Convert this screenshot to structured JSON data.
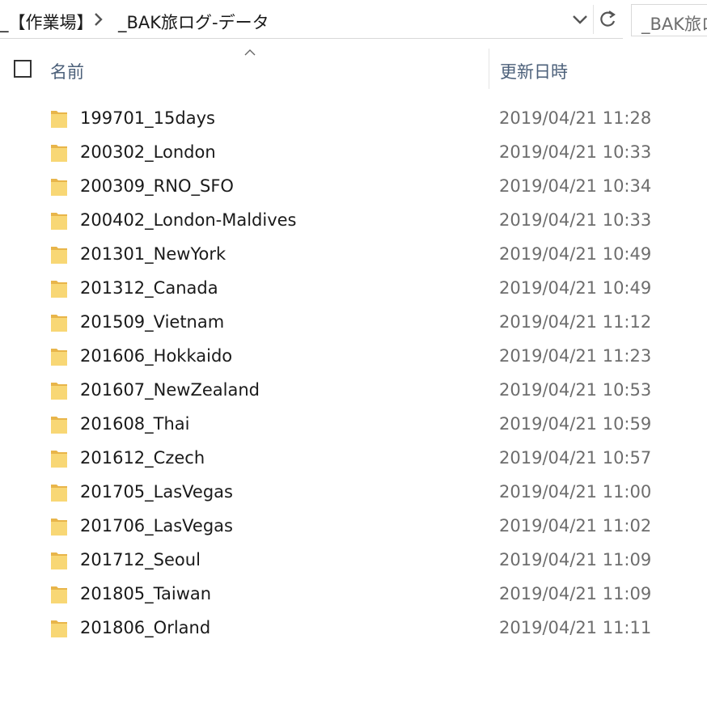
{
  "address_bar": {
    "parent_crumb": "_【作業場】",
    "current_crumb": "_BAK旅ログ-データ",
    "separator_icon": "chevron-right-icon",
    "dropdown_icon": "chevron-down-icon",
    "refresh_icon": "refresh-icon"
  },
  "search": {
    "text": "_BAK旅ロ"
  },
  "columns": {
    "name": "名前",
    "date_modified": "更新日時",
    "sort_icon": "sort-up-icon"
  },
  "files": [
    {
      "name": "199701_15days",
      "date": "2019/04/21 11:28"
    },
    {
      "name": "200302_London",
      "date": "2019/04/21 10:33"
    },
    {
      "name": "200309_RNO_SFO",
      "date": "2019/04/21 10:34"
    },
    {
      "name": "200402_London-Maldives",
      "date": "2019/04/21 10:33"
    },
    {
      "name": "201301_NewYork",
      "date": "2019/04/21 10:49"
    },
    {
      "name": "201312_Canada",
      "date": "2019/04/21 10:49"
    },
    {
      "name": "201509_Vietnam",
      "date": "2019/04/21 11:12"
    },
    {
      "name": "201606_Hokkaido",
      "date": "2019/04/21 11:23"
    },
    {
      "name": "201607_NewZealand",
      "date": "2019/04/21 10:53"
    },
    {
      "name": "201608_Thai",
      "date": "2019/04/21 10:59"
    },
    {
      "name": "201612_Czech",
      "date": "2019/04/21 10:57"
    },
    {
      "name": "201705_LasVegas",
      "date": "2019/04/21 11:00"
    },
    {
      "name": "201706_LasVegas",
      "date": "2019/04/21 11:02"
    },
    {
      "name": "201712_Seoul",
      "date": "2019/04/21 11:09"
    },
    {
      "name": "201805_Taiwan",
      "date": "2019/04/21 11:09"
    },
    {
      "name": "201806_Orland",
      "date": "2019/04/21 11:11"
    }
  ],
  "colors": {
    "folder_body": "#f8d775",
    "folder_back": "#e8b54a",
    "header_text": "#4c607a",
    "date_text": "#6d6d6d"
  }
}
